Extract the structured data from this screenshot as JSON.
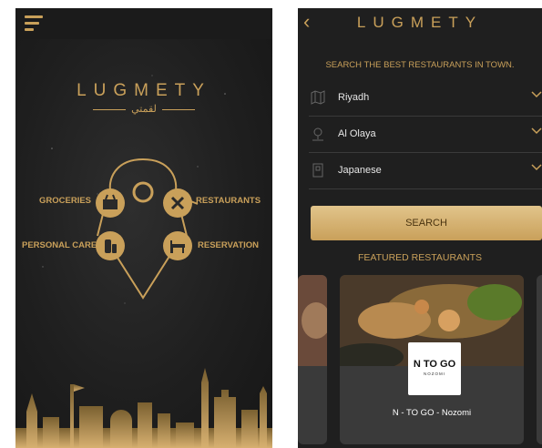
{
  "left_screen": {
    "logo": "LUGMETY",
    "logo_arabic": "لقمتي",
    "categories": {
      "groceries": "GROCERIES",
      "restaurants": "RESTAURANTS",
      "personal_care": "PERSONAL CARE",
      "reservation": "RESERVATION"
    }
  },
  "right_screen": {
    "logo": "LUGMETY",
    "tagline": "SEARCH THE BEST RESTAURANTS IN TOWN.",
    "filters": [
      {
        "icon": "map-icon",
        "value": "Riyadh"
      },
      {
        "icon": "location-pin-icon",
        "value": "Al Olaya"
      },
      {
        "icon": "menu-card-icon",
        "value": "Japanese"
      }
    ],
    "search_label": "SEARCH",
    "featured_label": "FEATURED RESTAURANTS",
    "card": {
      "badge_title": "N TO GO",
      "badge_subtitle": "NOZOMI",
      "name": "N - TO GO - Nozomi"
    }
  },
  "colors": {
    "gold": "#c9a05a",
    "background": "#1f1f1f"
  }
}
